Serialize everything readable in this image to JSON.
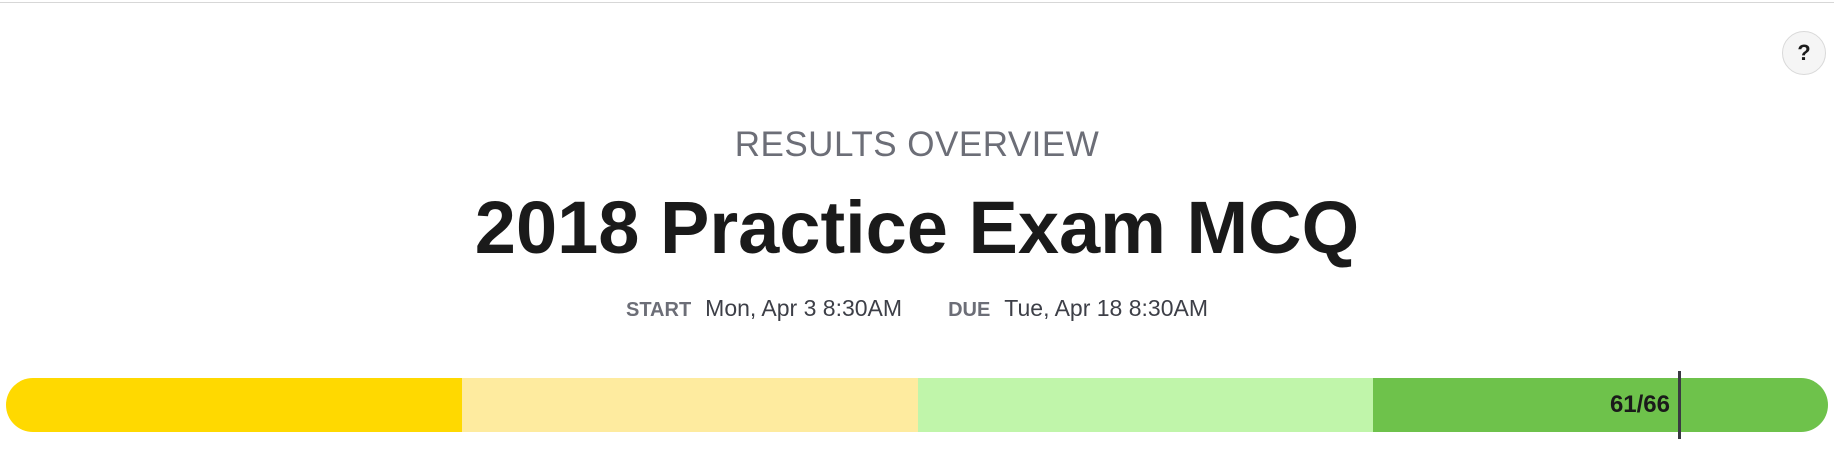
{
  "header": {
    "help_label": "?"
  },
  "overview": {
    "label": "RESULTS OVERVIEW",
    "title": "2018 Practice Exam MCQ"
  },
  "dates": {
    "start_label": "START",
    "start_value": "Mon, Apr 3 8:30AM",
    "due_label": "DUE",
    "due_value": "Tue, Apr 18 8:30AM"
  },
  "score": {
    "text": "61/66",
    "earned": 61,
    "total": 66,
    "segment_colors": [
      "#ffd900",
      "#feeb9f",
      "#c0f5aa",
      "#6ec24b"
    ]
  }
}
